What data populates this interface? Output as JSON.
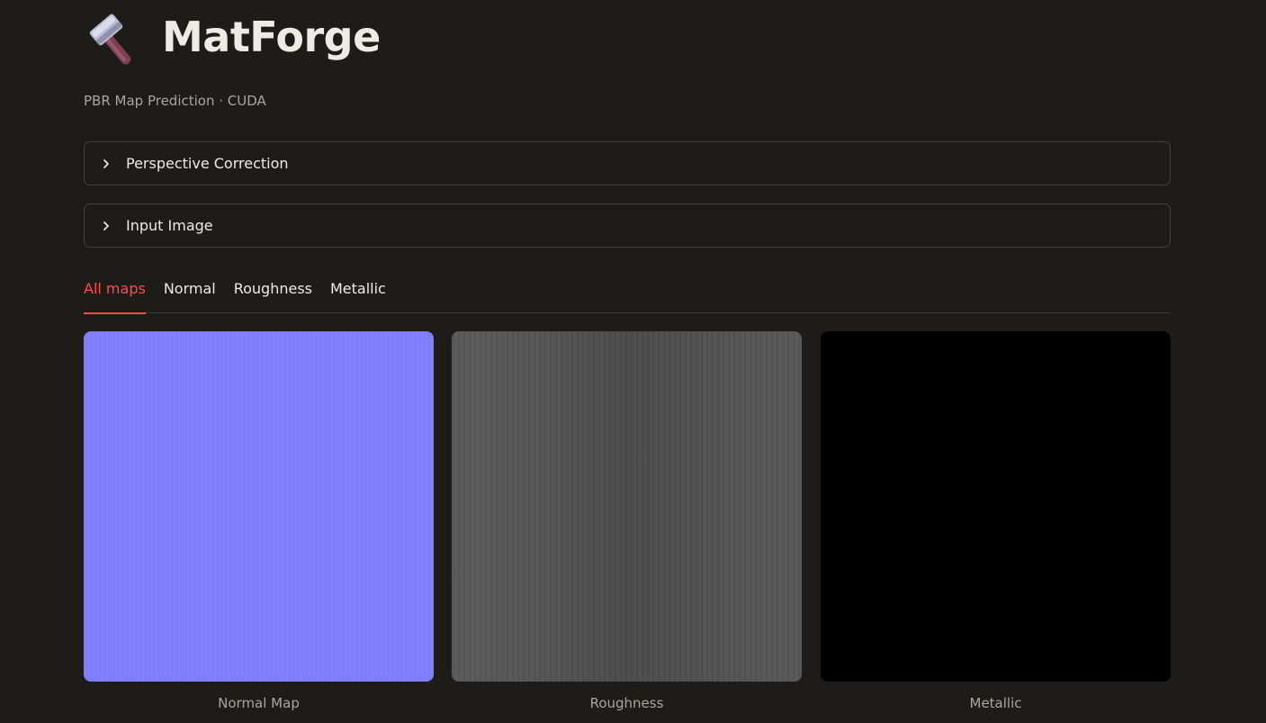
{
  "app": {
    "title": "MatForge",
    "subtitle": "PBR Map Prediction · CUDA",
    "logo_icon": "hammer-icon"
  },
  "expanders": [
    {
      "label": "Perspective Correction",
      "icon": "chevron-right-icon",
      "expanded": false
    },
    {
      "label": "Input Image",
      "icon": "chevron-right-icon",
      "expanded": false
    }
  ],
  "tabs": [
    {
      "label": "All maps",
      "active": true
    },
    {
      "label": "Normal",
      "active": false
    },
    {
      "label": "Roughness",
      "active": false
    },
    {
      "label": "Metallic",
      "active": false
    }
  ],
  "maps": [
    {
      "caption": "Normal Map",
      "color": "#8080ff"
    },
    {
      "caption": "Roughness",
      "color": "#555555"
    },
    {
      "caption": "Metallic",
      "color": "#000000"
    }
  ],
  "colors": {
    "background": "#1e1c19",
    "accent": "#ff4b4b",
    "border": "#44423d"
  }
}
